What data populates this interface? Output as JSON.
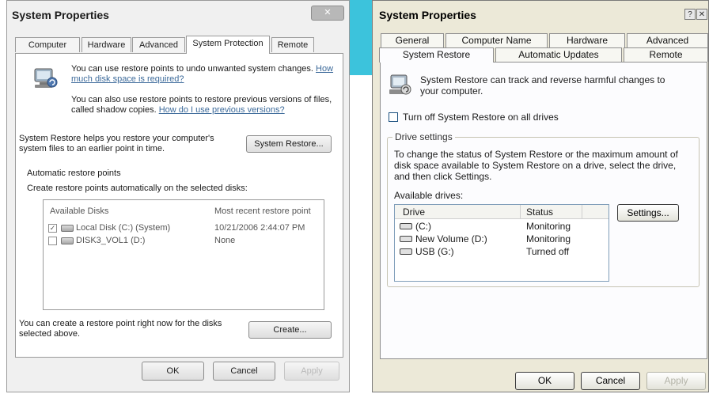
{
  "colors": {
    "banner": "#3cc3dc",
    "vista_bg": "#f0f0f0",
    "xp_bg": "#ece9d8",
    "link": "#3c6a9a"
  },
  "vista": {
    "title": "System Properties",
    "close_label": "✕",
    "tabs": [
      {
        "label": "Computer Name"
      },
      {
        "label": "Hardware"
      },
      {
        "label": "Advanced"
      },
      {
        "label": "System Protection",
        "active": true
      },
      {
        "label": "Remote"
      }
    ],
    "intro_text": "You can use restore points to undo unwanted system changes.",
    "intro_link": "How much disk space is required?",
    "shadow_text": "You can also use restore points to restore previous versions of files, called shadow copies.",
    "shadow_link": "How do I use previous versions?",
    "restore_text": "System Restore helps you restore your computer's system files to an earlier point in time.",
    "restore_button": "System Restore...",
    "auto_heading": "Automatic restore points",
    "auto_desc": "Create restore points automatically on the selected disks:",
    "disk_table": {
      "headers": [
        "Available Disks",
        "Most recent restore point"
      ],
      "rows": [
        {
          "name": "Local Disk (C:) (System)",
          "point": "10/21/2006 2:44:07 PM",
          "checked": true
        },
        {
          "name": "DISK3_VOL1 (D:)",
          "point": "None",
          "checked": false
        }
      ]
    },
    "create_text": "You can create a restore point right now for the disks selected above.",
    "create_button": "Create...",
    "buttons": {
      "ok": "OK",
      "cancel": "Cancel",
      "apply": "Apply"
    }
  },
  "xp": {
    "title": "System Properties",
    "help_label": "?",
    "close_label": "✕",
    "tabs_back": [
      {
        "label": "General"
      },
      {
        "label": "Computer Name"
      },
      {
        "label": "Hardware"
      },
      {
        "label": "Advanced"
      }
    ],
    "tabs_front": [
      {
        "label": "System Restore",
        "active": true
      },
      {
        "label": "Automatic Updates"
      },
      {
        "label": "Remote"
      }
    ],
    "intro_text": "System Restore can track and reverse harmful changes to your computer.",
    "turn_off_label": "Turn off System Restore on all drives",
    "group_label": "Drive settings",
    "group_text": "To change the status of System Restore or the maximum amount of disk space available to System Restore on a drive, select the drive, and then click Settings.",
    "available_label": "Available drives:",
    "drive_table": {
      "headers": [
        "Drive",
        "Status"
      ],
      "rows": [
        {
          "name": "(C:)",
          "status": "Monitoring"
        },
        {
          "name": "New Volume (D:)",
          "status": "Monitoring"
        },
        {
          "name": "USB (G:)",
          "status": "Turned off"
        }
      ]
    },
    "settings_button": "Settings...",
    "buttons": {
      "ok": "OK",
      "cancel": "Cancel",
      "apply": "Apply"
    }
  }
}
